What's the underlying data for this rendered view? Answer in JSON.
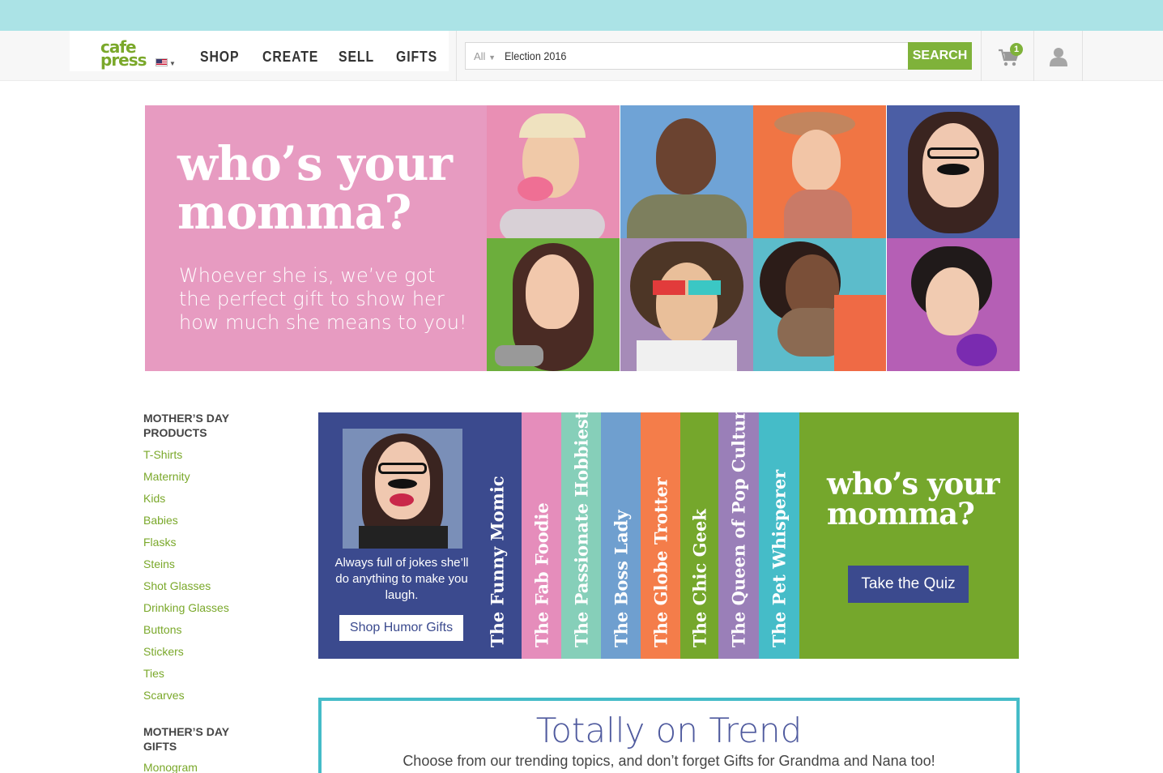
{
  "header": {
    "logo_line1": "cafe",
    "logo_line2": "press",
    "nav": [
      "SHOP",
      "CREATE",
      "SELL",
      "GIFTS"
    ],
    "search_scope": "All",
    "search_value": "Election 2016",
    "search_button": "SEARCH",
    "cart_count": "1",
    "brand_green": "#7fb23a",
    "top_strip_color": "#abe3e6"
  },
  "hero": {
    "title_line1": "who’s your",
    "title_line2": "momma?",
    "subtitle": "Whoever she is, we’ve got the perfect gift to show her how much she means to you!",
    "background": "#e79bc1"
  },
  "sidebar": {
    "products_heading": [
      "MOTHER’S DAY",
      "PRODUCTS"
    ],
    "products": [
      "T-Shirts",
      "Maternity",
      "Kids",
      "Babies",
      "Flasks",
      "Steins",
      "Shot Glasses",
      "Drinking Glasses",
      "Buttons",
      "Stickers",
      "Ties",
      "Scarves"
    ],
    "gifts_heading": [
      "MOTHER’S DAY",
      "GIFTS"
    ],
    "gifts": [
      "Monogram"
    ]
  },
  "persona": {
    "description": "Always full of jokes she’ll do anything to make you laugh.",
    "button": "Shop Humor Gifts",
    "stripes": [
      {
        "label": "The Funny Momic",
        "color": "#3b4a8e"
      },
      {
        "label": "The Fab Foodie",
        "color": "#e58dbb"
      },
      {
        "label": "The Passionate Hobbiest",
        "color": "#86cfb9"
      },
      {
        "label": "The Boss Lady",
        "color": "#6f9fcf"
      },
      {
        "label": "The Globe Trotter",
        "color": "#f47d4a"
      },
      {
        "label": "The Chic Geek",
        "color": "#75a72c"
      },
      {
        "label": "The Queen of Pop Culture",
        "color": "#9a7fb8"
      },
      {
        "label": "The Pet Whisperer",
        "color": "#45bcc8"
      }
    ],
    "quiz_title_line1": "who’s your",
    "quiz_title_line2": "momma?",
    "quiz_button": "Take the Quiz"
  },
  "trend": {
    "title": "Totally on Trend",
    "subtitle": "Choose from our trending topics, and don’t forget Gifts for Grandma and Nana too!"
  }
}
